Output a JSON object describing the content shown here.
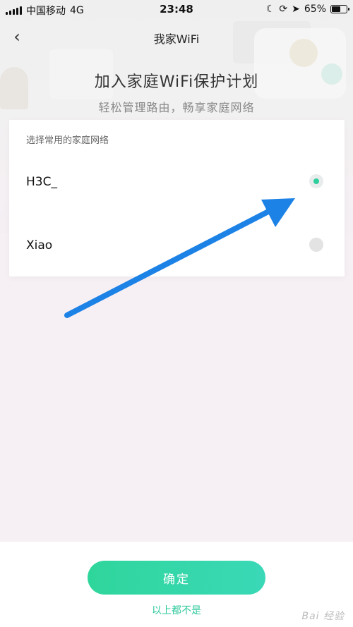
{
  "status_bar": {
    "carrier": "中国移动",
    "network": "4G",
    "time": "23:48",
    "battery": "65%",
    "battery_level": 0.65,
    "icons": [
      "signal-icon",
      "moon-icon",
      "rotation-lock-icon",
      "location-arrow-icon",
      "battery-icon"
    ]
  },
  "nav": {
    "back_icon": "chevron-left-icon",
    "title": "我家WiFi"
  },
  "hero": {
    "title": "加入家庭WiFi保护计划",
    "subtitle": "轻松管理路由，畅享家庭网络"
  },
  "wifi_card": {
    "header": "选择常用的家庭网络",
    "networks": [
      {
        "name": "H3C_",
        "selected": true
      },
      {
        "name": "Xiao",
        "selected": false
      }
    ]
  },
  "actions": {
    "confirm_label": "确定",
    "none_label": "以上都不是"
  },
  "watermark": "Bai 经验",
  "colors": {
    "accent": "#2fcf9d",
    "arrow": "#1d82e6"
  }
}
